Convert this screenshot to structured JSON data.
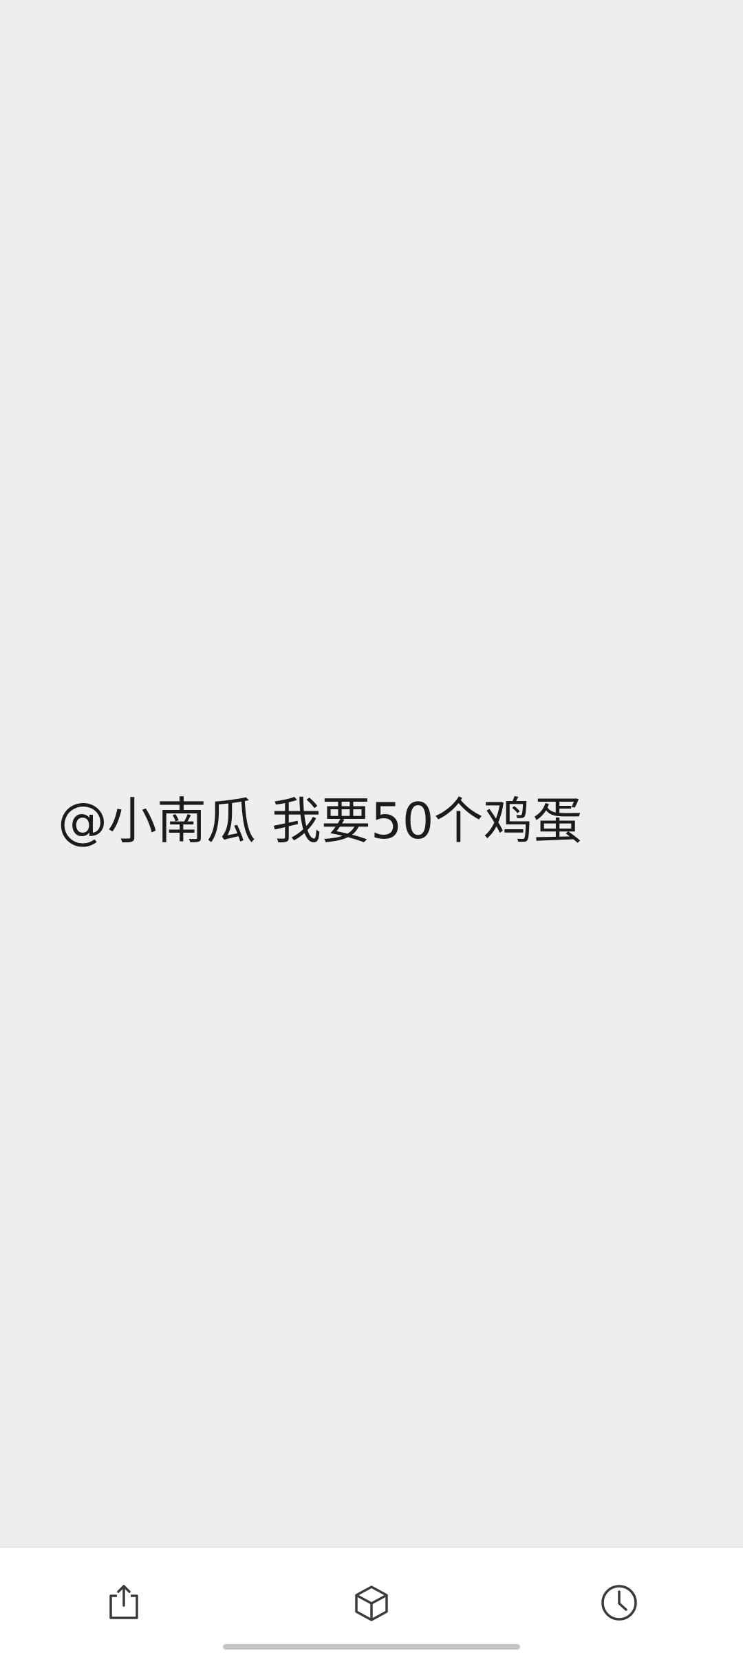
{
  "message": {
    "text": "@小南瓜 我要50个鸡蛋"
  },
  "bottom_bar": {
    "items": [
      {
        "icon": "share-icon"
      },
      {
        "icon": "cube-icon"
      },
      {
        "icon": "clock-icon"
      }
    ]
  },
  "colors": {
    "background": "#eeeeee",
    "bar_background": "#ffffff",
    "text": "#1b1b1b",
    "icon": "#3b3b3b",
    "home_indicator": "#c4c4c4"
  }
}
